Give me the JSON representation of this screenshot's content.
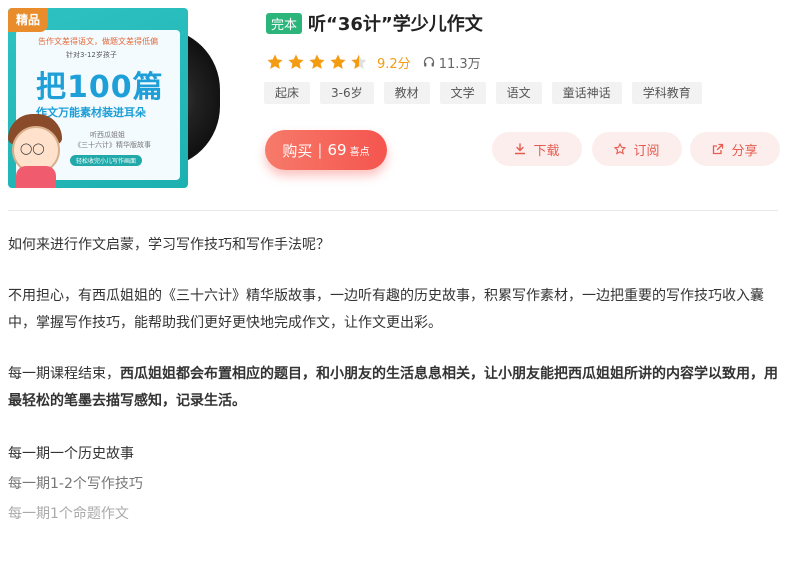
{
  "cover": {
    "badge": "精品",
    "line1": "告作文差得语文，做题文差得低偏",
    "line2": "针对3-12岁孩子",
    "big": "把100篇",
    "sub": "作文万能素材装进耳朵",
    "small1": "听西瓜姐姐",
    "small2": "《三十六计》精华版故事",
    "pill": "轻松收完小儿写作画面"
  },
  "album": {
    "status_tag": "完本",
    "title": "听“36计”学少儿作文",
    "rating": 4.5,
    "score": "9.2分",
    "listens": "11.3万"
  },
  "tags": [
    "起床",
    "3-6岁",
    "教材",
    "文学",
    "语文",
    "童话神话",
    "学科教育"
  ],
  "buy": {
    "label": "购买",
    "price": "69",
    "unit": "喜点"
  },
  "actions": {
    "download": "下载",
    "subscribe": "订阅",
    "share": "分享"
  },
  "description": {
    "p1": "如何来进行作文启蒙，学习写作技巧和写作手法呢？",
    "p2": "不用担心，有西瓜姐姐的《三十六计》精华版故事，一边听有趣的历史故事，积累写作素材，一边把重要的写作技巧收入囊中，掌握写作技巧，能帮助我们更好更快地完成作文，让作文更出彩。",
    "p3_prefix": "每一期课程结束，",
    "p3_bold": "西瓜姐姐都会布置相应的题目，和小朋友的生活息息相关，让小朋友能把西瓜姐姐所讲的内容学以致用，用最轻松的笔墨去描写感知，记录生活。",
    "list": [
      "每一期一个历史故事",
      "每一期1-2个写作技巧",
      "每一期1个命题作文"
    ]
  },
  "colors": {
    "accent": "#f5554e",
    "score": "#f39c12",
    "complete": "#2bb57a"
  }
}
